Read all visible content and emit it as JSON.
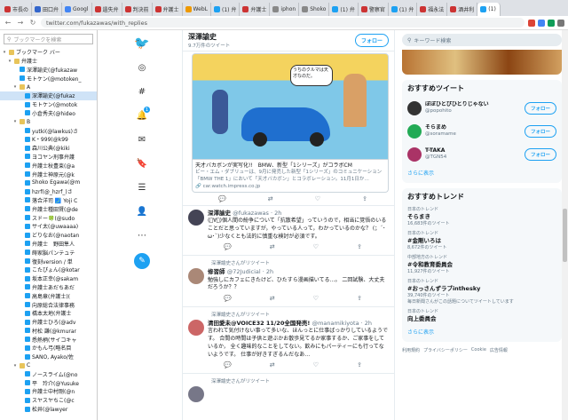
{
  "tabs": [
    {
      "label": "市長の",
      "color": "#c33"
    },
    {
      "label": "田口弁",
      "color": "#36c"
    },
    {
      "label": "Googl",
      "color": "#4285f4"
    },
    {
      "label": "遺失弁",
      "color": "#c33"
    },
    {
      "label": "判決前",
      "color": "#c33"
    },
    {
      "label": "弁護士",
      "color": "#c33"
    },
    {
      "label": "WebL",
      "color": "#e90"
    },
    {
      "label": "(1) 弁",
      "color": "#1da1f2"
    },
    {
      "label": "弁護士",
      "color": "#c33"
    },
    {
      "label": "iphon",
      "color": "#888"
    },
    {
      "label": "Shoko",
      "color": "#888"
    },
    {
      "label": "(1) 弁",
      "color": "#1da1f2"
    },
    {
      "label": "警察官",
      "color": "#c33"
    },
    {
      "label": "(1) 弁",
      "color": "#1da1f2"
    },
    {
      "label": "福永法",
      "color": "#c33"
    },
    {
      "label": "酒井利",
      "color": "#c33"
    },
    {
      "label": "(1)",
      "color": "#1da1f2"
    }
  ],
  "url": "twitter.com/fukazawas/with_replies",
  "bookmark_search_placeholder": "ブックマークを検索",
  "bookmarks": [
    {
      "label": "ブックマーク バー",
      "type": "folder",
      "indent": 0,
      "toggle": "▾"
    },
    {
      "label": "弁護士",
      "type": "folder",
      "indent": 1,
      "toggle": "▾"
    },
    {
      "label": "深澤諭史(@fukazaw",
      "type": "tw",
      "indent": 2,
      "toggle": ""
    },
    {
      "label": "モトケン(@motoken_",
      "type": "tw",
      "indent": 2,
      "toggle": ""
    },
    {
      "label": "A",
      "type": "folder",
      "indent": 2,
      "toggle": "▾"
    },
    {
      "label": "深澤諭史(@fukaz",
      "type": "tw",
      "indent": 3,
      "toggle": "",
      "selected": true
    },
    {
      "label": "モトケン(@motok",
      "type": "tw",
      "indent": 3,
      "toggle": ""
    },
    {
      "label": "小倉秀夫(@hideo",
      "type": "tw",
      "indent": 3,
      "toggle": ""
    },
    {
      "label": "B",
      "type": "folder",
      "indent": 2,
      "toggle": "▾"
    },
    {
      "label": "yutki(@lawkus)さ",
      "type": "tw",
      "indent": 3,
      "toggle": ""
    },
    {
      "label": "K・999(@k99",
      "type": "tw",
      "indent": 3,
      "toggle": ""
    },
    {
      "label": "森川公典(@kiki",
      "type": "tw",
      "indent": 3,
      "toggle": ""
    },
    {
      "label": "ヨコヤン刑事弁護",
      "type": "tw",
      "indent": 3,
      "toggle": ""
    },
    {
      "label": "弁護士秋豊束(@a",
      "type": "tw",
      "indent": 3,
      "toggle": ""
    },
    {
      "label": "弁護士神原元(@k",
      "type": "tw",
      "indent": 3,
      "toggle": ""
    },
    {
      "label": "Shoko Egawa(@m",
      "type": "tw",
      "indent": 3,
      "toggle": ""
    },
    {
      "label": "hzrf(@_hzrf_)さ",
      "type": "tw",
      "indent": 3,
      "toggle": ""
    },
    {
      "label": "落合洋司 🗾 Yoji C",
      "type": "tw",
      "indent": 3,
      "toggle": ""
    },
    {
      "label": "弁護士種田賢(@de",
      "type": "tw",
      "indent": 3,
      "toggle": ""
    },
    {
      "label": "スドー🍀(@sudo",
      "type": "tw",
      "indent": 3,
      "toggle": ""
    },
    {
      "label": "サイ太(@uwaaaa)",
      "type": "tw",
      "indent": 3,
      "toggle": ""
    },
    {
      "label": "どりなお(@naotan",
      "type": "tw",
      "indent": 3,
      "toggle": ""
    },
    {
      "label": "弁護士　野田隼人",
      "type": "tw",
      "indent": 3,
      "toggle": ""
    },
    {
      "label": "蒔家脳パンテュテ",
      "type": "tw",
      "indent": 3,
      "toggle": ""
    },
    {
      "label": "復刻version / 単",
      "type": "tw",
      "indent": 3,
      "toggle": ""
    },
    {
      "label": "こたぴょん(@kotar",
      "type": "tw",
      "indent": 3,
      "toggle": ""
    },
    {
      "label": "坂本正幸(@sakam",
      "type": "tw",
      "indent": 3,
      "toggle": ""
    },
    {
      "label": "弁護士あだちあだ",
      "type": "tw",
      "indent": 3,
      "toggle": ""
    },
    {
      "label": "高島章(弁護士)(",
      "type": "tw",
      "indent": 3,
      "toggle": ""
    },
    {
      "label": "向原総合法律事務",
      "type": "tw",
      "indent": 3,
      "toggle": ""
    },
    {
      "label": "橋本太地(弁護士",
      "type": "tw",
      "indent": 3,
      "toggle": ""
    },
    {
      "label": "弁護士ひろ(@adv",
      "type": "tw",
      "indent": 3,
      "toggle": ""
    },
    {
      "label": "村松 謙(@kmurar",
      "type": "tw",
      "indent": 3,
      "toggle": ""
    },
    {
      "label": "悉熱柄(サイコキャ",
      "type": "tw",
      "indent": 3,
      "toggle": ""
    },
    {
      "label": "かもん弓(略名目",
      "type": "tw",
      "indent": 3,
      "toggle": ""
    },
    {
      "label": "SANO, Ayako/佐",
      "type": "tw",
      "indent": 3,
      "toggle": ""
    },
    {
      "label": "C",
      "type": "folder",
      "indent": 2,
      "toggle": "▾"
    },
    {
      "label": "ノースライム(@no",
      "type": "tw",
      "indent": 3,
      "toggle": ""
    },
    {
      "label": "平　玲介(@Yusuke",
      "type": "tw",
      "indent": 3,
      "toggle": ""
    },
    {
      "label": "弁護士中村剛(@n",
      "type": "tw",
      "indent": 3,
      "toggle": ""
    },
    {
      "label": "スヤスヤちこ(@c",
      "type": "tw",
      "indent": 3,
      "toggle": ""
    },
    {
      "label": "松井(@lawyer",
      "type": "tw",
      "indent": 3,
      "toggle": ""
    }
  ],
  "nav_icons": [
    "twitter-bird-icon",
    "explore-hashtag-icon",
    "settings-gear-icon",
    "hashtag-icon",
    "notifications-bell-icon",
    "messages-mail-icon",
    "bookmarks-icon",
    "lists-icon",
    "profile-icon",
    "more-icon",
    "compose-tweet-icon"
  ],
  "notification_count": "1",
  "profile": {
    "name": "深澤諭史",
    "tweet_count": "9.7万件のツイート",
    "follow_label": "フォロー"
  },
  "card": {
    "bubble": "うちのクルマは天才なのだ。",
    "title": "天才バカボンが実写化!!　BMW、新型「1シリーズ」がコラボCM",
    "desc": "ビー・エム・ダブリューは、9月に発売した新型「1シリーズ」のコミュニケーション「BMW THE 1」において「天才バカボン」とコラボレーション。11月1日か…",
    "link": "🔗 car.watch.impress.co.jp"
  },
  "tweets": [
    {
      "rt": "",
      "name": "深澤諭史",
      "handle": "@fukazawas · 2h",
      "text": "(ﾟ∀ﾟ)個人間の紛争について「抗散希望」っていうので，相当に覚悟のいることだと思っていますが，やっている人って，わかっているのかな？ (；´･ω･`)少なくとも法的に慎重な検討が必須です。",
      "avatar": "#445"
    },
    {
      "rt": "深澤諭史さんがリツイート",
      "name": "修習師",
      "handle": "@72Judicial · 2h",
      "text": "勉強しにカフェにきたけど、ひたすら漫画描いてる…。 二回試験、大丈夫だろうか？？",
      "avatar": "#a87"
    },
    {
      "rt": "深澤諭史さんがリツイート",
      "name": "清田愛未@VOICE32 11/20全国発売!",
      "handle": "@manamikiyota · 2h",
      "text": "言われて気付けない事って多いな、ほんっとに仕事ばっかりしているようです。 合間の時間は子供と遊ぶかお散歩見てるか家事するか、ご家事をしているか， 全く趣味的なことをしてない。飲みにもパーティーにも行ってないようです。 仕事が好きすぎるんだなあ…",
      "avatar": "#c66"
    },
    {
      "rt": "深澤諭史さんがリツイート",
      "name": "",
      "handle": "",
      "text": "",
      "avatar": "#778"
    }
  ],
  "right": {
    "search_placeholder": "キーワード検索",
    "suggest_title": "おすすめツイート",
    "suggestions": [
      {
        "name": "ぽぽひとぴひとりじゃない",
        "handle": "@popohito",
        "color": "#333",
        "btn": "フォロー"
      },
      {
        "name": "そらまめ",
        "handle": "@soramame",
        "color": "#2a5",
        "btn": "フォロー"
      },
      {
        "name": "T-TAKA",
        "handle": "@TGN54",
        "color": "#a36",
        "btn": "フォロー"
      }
    ],
    "more": "さらに表示",
    "trends_title": "おすすめトレンド",
    "trends": [
      {
        "ctx": "日本のトレンド",
        "title": "そらまき",
        "count": "16,683件のツイート"
      },
      {
        "ctx": "日本のトレンド",
        "title": "#金剛いろは",
        "count": "8,672件のツイート"
      },
      {
        "ctx": "中部地方のトレンド",
        "title": "#令和教育委員会",
        "count": "11,927件のツイート"
      },
      {
        "ctx": "日本のトレンド",
        "title": "#おっさんずラブinthesky",
        "count": "39,740件のツイート",
        "extra": "毎日新聞さんがこの話題についてツイートしています"
      },
      {
        "ctx": "日本のトレンド",
        "title": "向上委員会",
        "count": ""
      }
    ],
    "trends_more": "さらに表示",
    "footer": [
      "利用規約",
      "プライバシーポリシー",
      "Cookie",
      "広告情報"
    ]
  }
}
